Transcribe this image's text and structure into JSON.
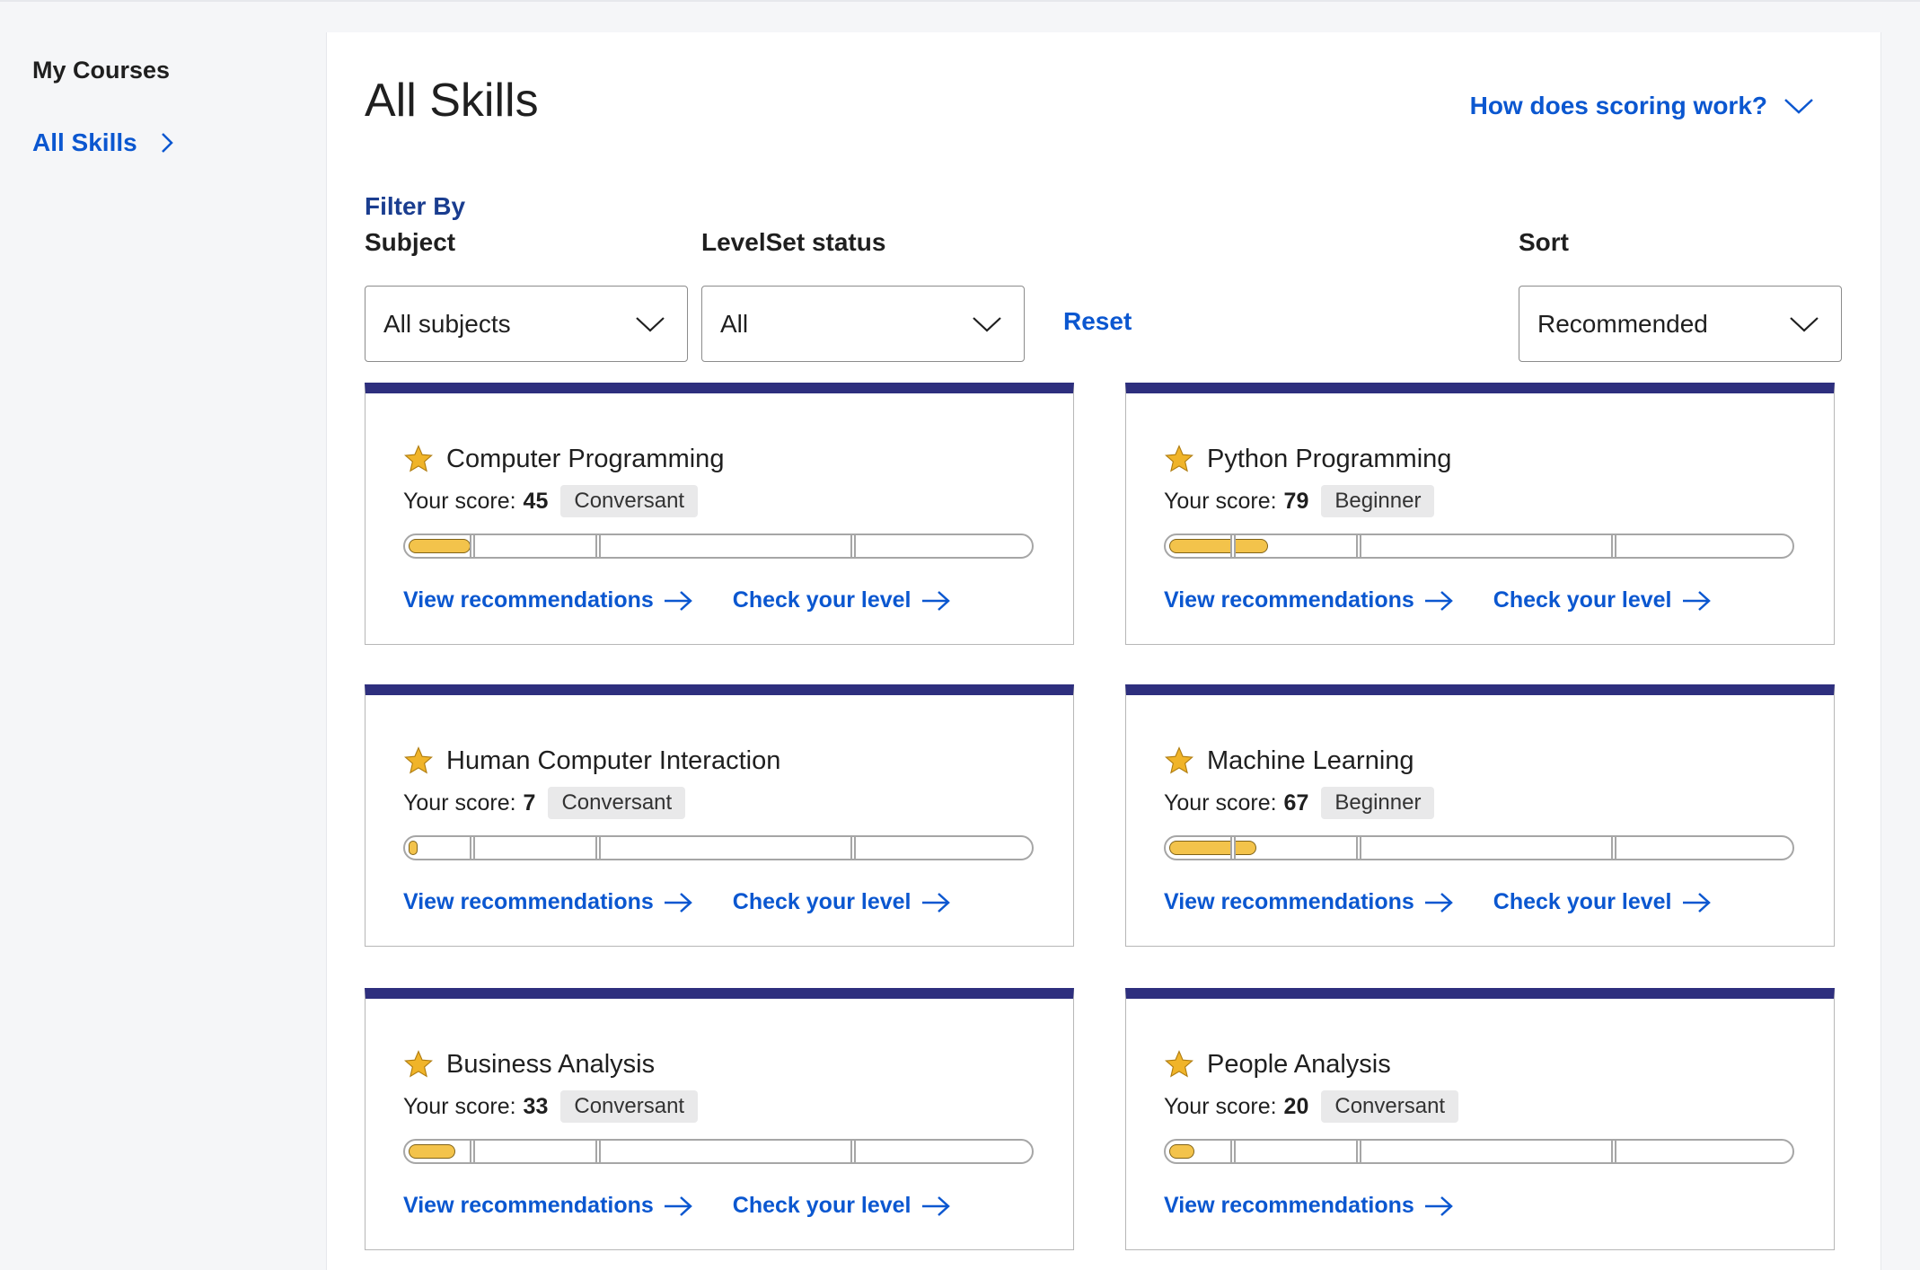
{
  "sidebar": {
    "heading": "My Courses",
    "items": [
      {
        "label": "All Skills",
        "active": true
      }
    ]
  },
  "main": {
    "title": "All Skills",
    "scoring_link": "How does scoring work?",
    "filter_heading": "Filter By",
    "filters": {
      "subject": {
        "label": "Subject",
        "value": "All subjects"
      },
      "levelset": {
        "label": "LevelSet status",
        "value": "All"
      },
      "reset_label": "Reset"
    },
    "sort": {
      "label": "Sort",
      "value": "Recommended"
    }
  },
  "labels": {
    "score_prefix": "Your score:",
    "view_recommendations": "View recommendations",
    "check_level": "Check your level"
  },
  "colors": {
    "accent_blue": "#0b57d0",
    "card_top_border": "#2e2f7e",
    "progress_fill": "#f3c34b",
    "star": "#f0b429"
  },
  "skills": [
    {
      "name": "Computer Programming",
      "score": "45",
      "level": "Conversant",
      "progress": 0.1,
      "show_check_level": true
    },
    {
      "name": "Python Programming",
      "score": "79",
      "level": "Beginner",
      "progress": 0.16,
      "show_check_level": true
    },
    {
      "name": "Human Computer Interaction",
      "score": "7",
      "level": "Conversant",
      "progress": 0.015,
      "show_check_level": true
    },
    {
      "name": "Machine Learning",
      "score": "67",
      "level": "Beginner",
      "progress": 0.14,
      "show_check_level": true
    },
    {
      "name": "Business Analysis",
      "score": "33",
      "level": "Conversant",
      "progress": 0.075,
      "show_check_level": true
    },
    {
      "name": "People Analysis",
      "score": "20",
      "level": "Conversant",
      "progress": 0.04,
      "show_check_level": false
    }
  ]
}
